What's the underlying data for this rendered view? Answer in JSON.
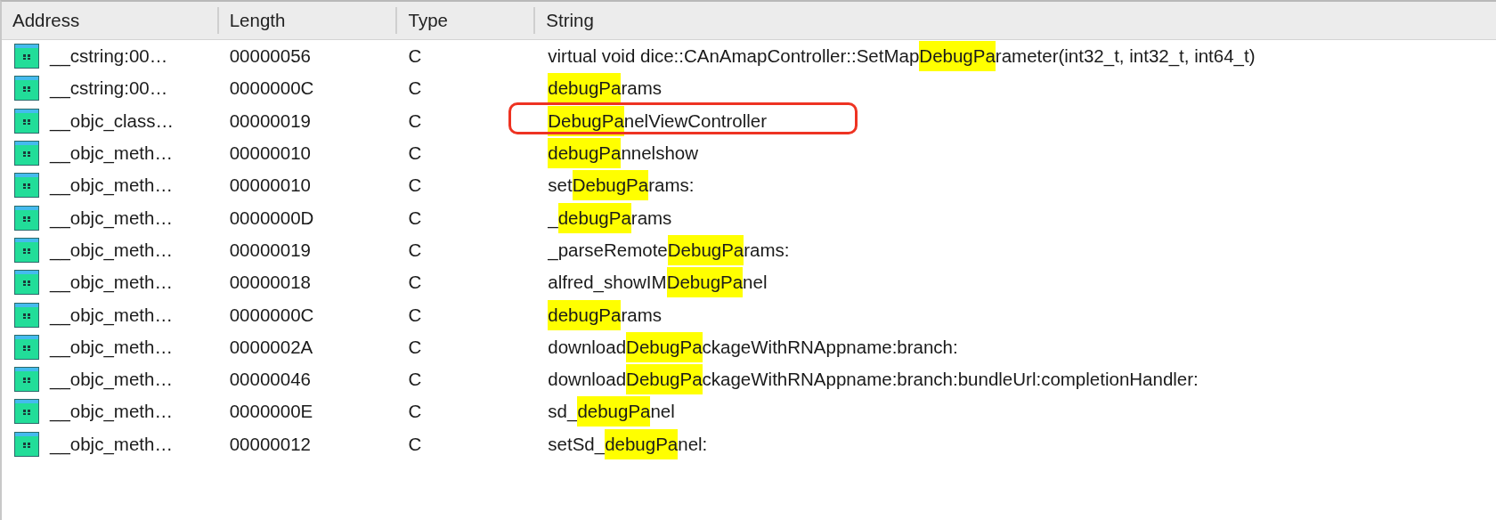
{
  "table": {
    "columns": [
      "Address",
      "Length",
      "Type",
      "String"
    ],
    "rows": [
      {
        "address": "__cstring:00…",
        "length": "00000056",
        "type": "C",
        "string": {
          "before": "virtual void dice::CAnAmapController::SetMap",
          "match": "DebugPa",
          "after": "rameter(int32_t, int32_t, int64_t)"
        },
        "annotated": false
      },
      {
        "address": "__cstring:00…",
        "length": "0000000C",
        "type": "C",
        "string": {
          "match": "debugPa",
          "after": "rams"
        },
        "annotated": false
      },
      {
        "address": "__objc_class…",
        "length": "00000019",
        "type": "C",
        "string": {
          "match": "DebugPa",
          "after": "nelViewController"
        },
        "annotated": true
      },
      {
        "address": "__objc_meth…",
        "length": "00000010",
        "type": "C",
        "string": {
          "match": "debugPa",
          "after": "nnelshow"
        },
        "annotated": false
      },
      {
        "address": "__objc_meth…",
        "length": "00000010",
        "type": "C",
        "string": {
          "before": "set",
          "match": "DebugPa",
          "after": "rams:"
        },
        "annotated": false
      },
      {
        "address": "__objc_meth…",
        "length": "0000000D",
        "type": "C",
        "string": {
          "before": "_",
          "match": "debugPa",
          "after": "rams"
        },
        "annotated": false
      },
      {
        "address": "__objc_meth…",
        "length": "00000019",
        "type": "C",
        "string": {
          "before": "_parseRemote",
          "match": "DebugPa",
          "after": "rams:"
        },
        "annotated": false
      },
      {
        "address": "__objc_meth…",
        "length": "00000018",
        "type": "C",
        "string": {
          "before": "alfred_showIM",
          "match": "DebugPa",
          "after": "nel"
        },
        "annotated": false
      },
      {
        "address": "__objc_meth…",
        "length": "0000000C",
        "type": "C",
        "string": {
          "match": "debugPa",
          "after": "rams"
        },
        "annotated": false
      },
      {
        "address": "__objc_meth…",
        "length": "0000002A",
        "type": "C",
        "string": {
          "before": "download",
          "match": "DebugPa",
          "after": "ckageWithRNAppname:branch:"
        },
        "annotated": false
      },
      {
        "address": "__objc_meth…",
        "length": "00000046",
        "type": "C",
        "string": {
          "before": "download",
          "match": "DebugPa",
          "after": "ckageWithRNAppname:branch:bundleUrl:completionHandler:"
        },
        "annotated": false
      },
      {
        "address": "__objc_meth…",
        "length": "0000000E",
        "type": "C",
        "string": {
          "before": "sd_",
          "match": "debugPa",
          "after": "nel"
        },
        "annotated": false
      },
      {
        "address": "__objc_meth…",
        "length": "00000012",
        "type": "C",
        "string": {
          "before": "setSd_",
          "match": "debugPa",
          "after": "nel:"
        },
        "annotated": false
      }
    ]
  }
}
